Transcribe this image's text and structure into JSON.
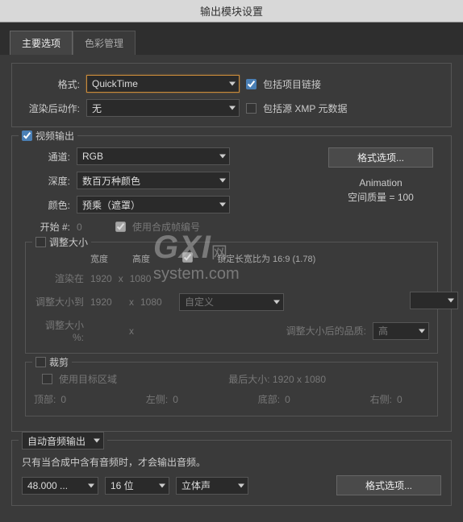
{
  "title": "输出模块设置",
  "tabs": {
    "main": "主要选项",
    "color": "色彩管理"
  },
  "format": {
    "label": "格式:",
    "value": "QuickTime",
    "include_link": "包括项目链接",
    "post_action_label": "渲染后动作:",
    "post_action_value": "无",
    "include_xmp": "包括源 XMP 元数据"
  },
  "video": {
    "legend": "视频输出",
    "channel_label": "通道:",
    "channel_value": "RGB",
    "depth_label": "深度:",
    "depth_value": "数百万种颜色",
    "color_label": "颜色:",
    "color_value": "预乘（遮罩）",
    "start_label": "开始 #:",
    "start_value": "0",
    "use_comp_num": "使用合成帧编号",
    "format_options_btn": "格式选项...",
    "codec_name": "Animation",
    "codec_quality": "空间质量 = 100"
  },
  "resize": {
    "legend": "调整大小",
    "width_h": "宽度",
    "height_h": "高度",
    "lock_aspect": "锁定长宽比为 16:9 (1.78)",
    "render_at": "渲染在",
    "r_w": "1920",
    "r_h": "1080",
    "resize_to": "调整大小到",
    "t_w": "1920",
    "t_h": "1080",
    "preset": "自定义",
    "percent_label": "调整大小 %:",
    "quality_label": "调整大小后的品质:",
    "quality_value": "高",
    "x": "x"
  },
  "crop": {
    "legend": "裁剪",
    "use_roi": "使用目标区域",
    "final_size": "最后大小: 1920 x 1080",
    "top": "顶部:",
    "left": "左侧:",
    "bottom": "底部:",
    "right": "右侧:",
    "zero": "0"
  },
  "audio": {
    "legend": "自动音频输出",
    "note": "只有当合成中含有音频时，才会输出音频。",
    "rate": "48.000 ...",
    "bits": "16 位",
    "ch": "立体声",
    "format_options_btn": "格式选项..."
  },
  "watermark": {
    "line1": "GXI",
    "suffix": "网",
    "line2": "system.com"
  }
}
